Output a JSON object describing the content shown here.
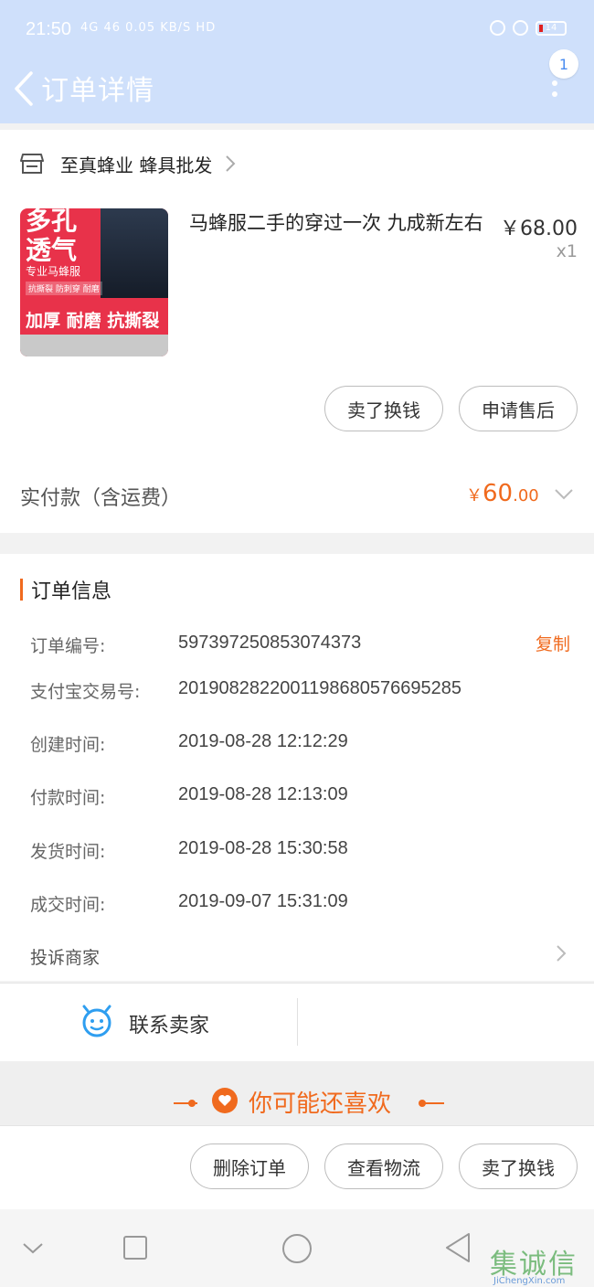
{
  "status_bar": {
    "time": "21:50",
    "net": "4G 46 0.05 KB/S HD",
    "battery": "14"
  },
  "header": {
    "title": "订单详情",
    "badge_count": "1"
  },
  "store": {
    "name": "至真蜂业 蜂具批发"
  },
  "product": {
    "thumb_text_1": "多孔",
    "thumb_text_2": "透气",
    "thumb_text_3": "专业马蜂服",
    "thumb_text_4": "抗撕裂 防刺穿 耐磨",
    "thumb_text_5": "加厚 耐磨 抗撕裂",
    "title": "马蜂服二手的穿过一次  九成新左右",
    "price": "￥68.00",
    "quantity": "x1"
  },
  "item_buttons": {
    "sell": "卖了换钱",
    "after_sale": "申请售后"
  },
  "payment": {
    "label": "实付款（含运费）",
    "currency": "￥",
    "integer": "60",
    "decimal": ".00"
  },
  "order_info": {
    "title": "订单信息",
    "copy_label": "复制",
    "rows": [
      {
        "key": "订单编号:",
        "value": "597397250853074373"
      },
      {
        "key": "支付宝交易号:",
        "value": "2019082822001198680576695285"
      },
      {
        "key": "创建时间:",
        "value": "2019-08-28 12:12:29"
      },
      {
        "key": "付款时间:",
        "value": "2019-08-28 12:13:09"
      },
      {
        "key": "发货时间:",
        "value": "2019-08-28 15:30:58"
      },
      {
        "key": "成交时间:",
        "value": "2019-09-07 15:31:09"
      }
    ],
    "complain": "投诉商家"
  },
  "contact": {
    "label": "联系卖家"
  },
  "recommend": {
    "label": "你可能还喜欢"
  },
  "bottom_actions": {
    "delete": "删除订单",
    "logistics": "查看物流",
    "sell": "卖了换钱"
  },
  "watermark": {
    "cn": "集诚信",
    "en": "JiChengXin.com"
  },
  "colors": {
    "header_bg": "#cfe0fb",
    "accent": "#f06a1e",
    "contact_icon": "#2e9ef0"
  }
}
